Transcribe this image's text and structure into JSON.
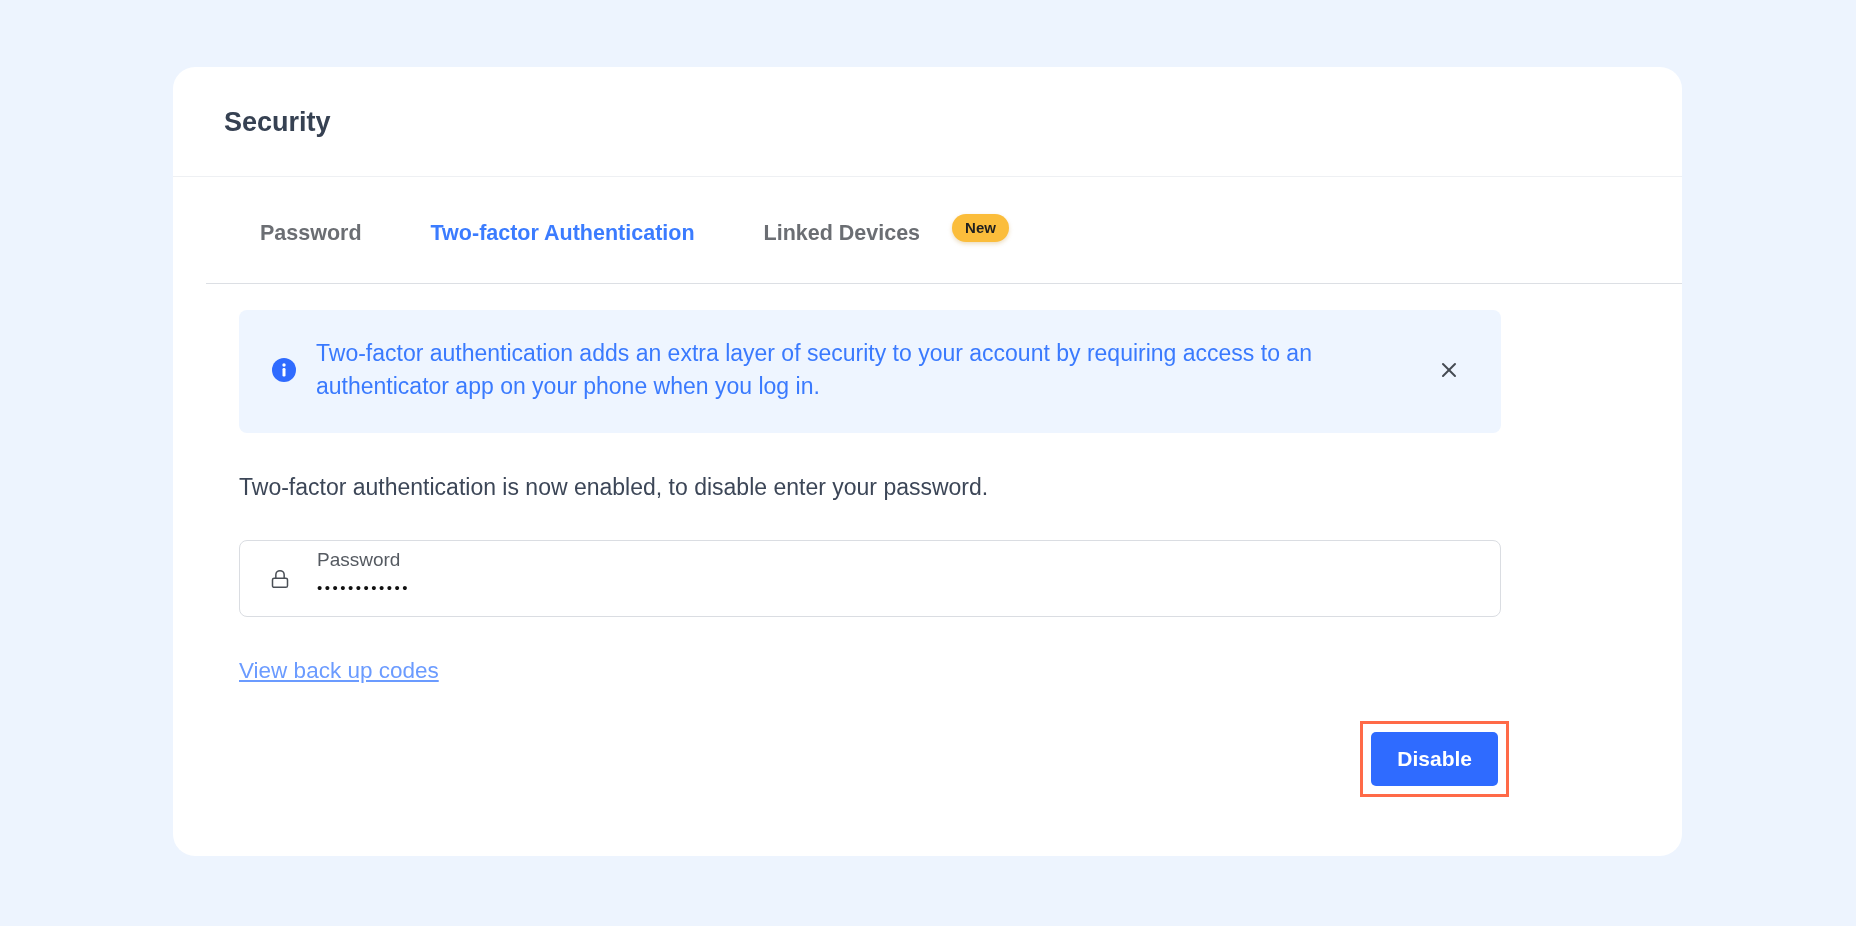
{
  "section": {
    "title": "Security"
  },
  "tabs": [
    {
      "label": "Password",
      "selected": false
    },
    {
      "label": "Two-factor Authentication",
      "selected": true
    },
    {
      "label": "Linked Devices",
      "selected": false,
      "badge": "New"
    }
  ],
  "info_banner": {
    "text": "Two-factor authentication adds an extra layer of security to your account by requiring access to an authenticator app on your phone when you log in."
  },
  "notice": "Two-factor authentication is now enabled, to disable enter your password.",
  "password_field": {
    "label": "Password",
    "value": "••••••••••••"
  },
  "backup_codes_link": "View back up codes",
  "disable_button": {
    "label": "Disable",
    "highlighted": true
  }
}
